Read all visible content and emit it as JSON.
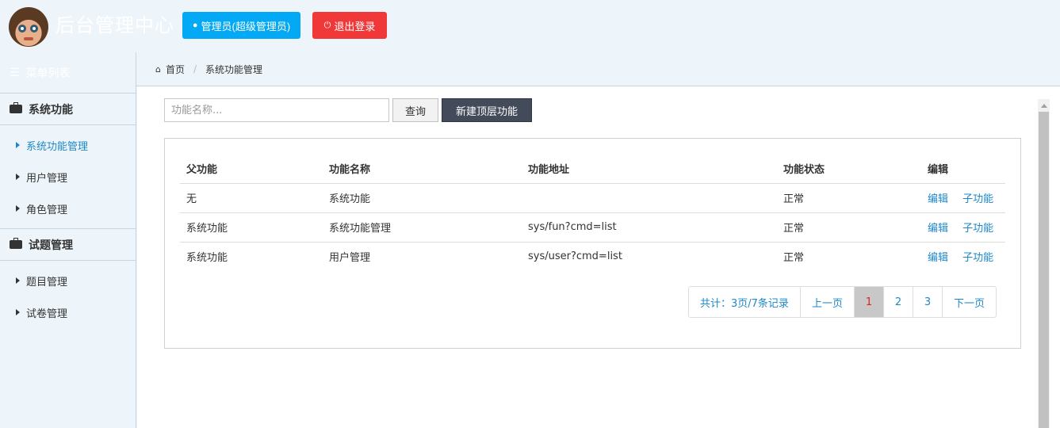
{
  "header": {
    "title": "后台管理中心",
    "admin_label": "管理员(超级管理员)",
    "logout_label": "退出登录"
  },
  "sidebar": {
    "menu_title": "菜单列表",
    "groups": [
      {
        "label": "系统功能",
        "items": [
          {
            "label": "系统功能管理"
          },
          {
            "label": "用户管理"
          },
          {
            "label": "角色管理"
          }
        ]
      },
      {
        "label": "试题管理",
        "items": [
          {
            "label": "题目管理"
          },
          {
            "label": "试卷管理"
          }
        ]
      }
    ]
  },
  "breadcrumb": {
    "home": "首页",
    "current": "系统功能管理"
  },
  "search": {
    "placeholder": "功能名称...",
    "query_label": "查询",
    "new_label": "新建顶层功能"
  },
  "table": {
    "headers": [
      "父功能",
      "功能名称",
      "功能地址",
      "功能状态",
      "编辑"
    ],
    "rows": [
      {
        "parent": "无",
        "name": "系统功能",
        "url": "",
        "status": "正常",
        "edit": "编辑",
        "child": "子功能"
      },
      {
        "parent": "系统功能",
        "name": "系统功能管理",
        "url": "sys/fun?cmd=list",
        "status": "正常",
        "edit": "编辑",
        "child": "子功能"
      },
      {
        "parent": "系统功能",
        "name": "用户管理",
        "url": "sys/user?cmd=list",
        "status": "正常",
        "edit": "编辑",
        "child": "子功能"
      }
    ]
  },
  "pager": {
    "summary": "共计：3页/7条记录",
    "prev": "上一页",
    "pages": [
      "1",
      "2",
      "3"
    ],
    "next": "下一页"
  },
  "icons": {
    "admin": "user-icon",
    "logout": "power-icon",
    "menu": "list-icon",
    "group": "briefcase-icon",
    "home": "home-icon"
  },
  "colors": {
    "admin_button": "#03a9f4",
    "logout_button": "#f03838",
    "link": "#1e88c7",
    "current_page": "#e02020"
  }
}
